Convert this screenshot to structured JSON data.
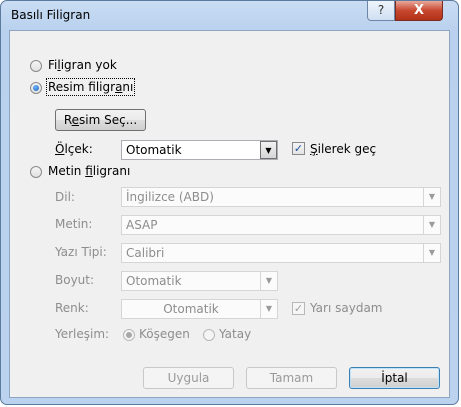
{
  "window": {
    "title": "Basılı Filigran",
    "help_label": "?",
    "close_label": "X"
  },
  "no_watermark": {
    "label_pre": "Fi",
    "label_u": "l",
    "label_post": "igran yok",
    "checked": false
  },
  "picture_watermark": {
    "label_pre": "Resim filigr",
    "label_u": "a",
    "label_post": "nı",
    "checked": true
  },
  "select_picture": {
    "label_pre": "R",
    "label_u": "e",
    "label_post": "sim Seç..."
  },
  "scale": {
    "label_u": "Ö",
    "label_post": "lçek:",
    "value": "Otomatik"
  },
  "washout": {
    "label_u": "Ş",
    "label_post": "ilerek geç",
    "checked": true
  },
  "text_watermark": {
    "label_pre": "Metin ",
    "label_u": "f",
    "label_post": "iligranı",
    "checked": false
  },
  "language": {
    "label": "Dil:",
    "value": "İngilizce (ABD)"
  },
  "text": {
    "label": "Metin:",
    "value": "ASAP"
  },
  "font": {
    "label": "Yazı Tipi:",
    "value": "Calibri"
  },
  "size": {
    "label": "Boyut:",
    "value": "Otomatik"
  },
  "color": {
    "label": "Renk:",
    "value": "Otomatik"
  },
  "semitransparent": {
    "label": "Yarı saydam",
    "checked": true
  },
  "layout": {
    "label": "Yerleşim:",
    "diagonal": "Köşegen",
    "horizontal": "Yatay",
    "diagonal_checked": true
  },
  "buttons": {
    "apply": "Uygula",
    "ok": "Tamam",
    "cancel": "İptal"
  },
  "icons": {
    "dropdown": "chevron-down-icon",
    "check": "checkmark-icon"
  },
  "colors": {
    "title_bar": "#c9dcf3",
    "close_button": "#c7472e",
    "client_bg": "#f0f0f0"
  }
}
